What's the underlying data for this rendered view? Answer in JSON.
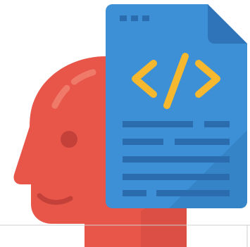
{
  "illustration": {
    "subject": "head-with-code-document-icon",
    "colors": {
      "head": "#e8564a",
      "head_shade": "#c4413a",
      "head_highlight": "#f07a6a",
      "document": "#3d8fd6",
      "document_fold": "#2f74b8",
      "document_shadow": "#2a6fb0",
      "document_lines": "#2a6cad",
      "code_symbols": "#f5b82e",
      "header_dots": "#2a6cad",
      "frame_line": "#cfcfcf"
    }
  }
}
